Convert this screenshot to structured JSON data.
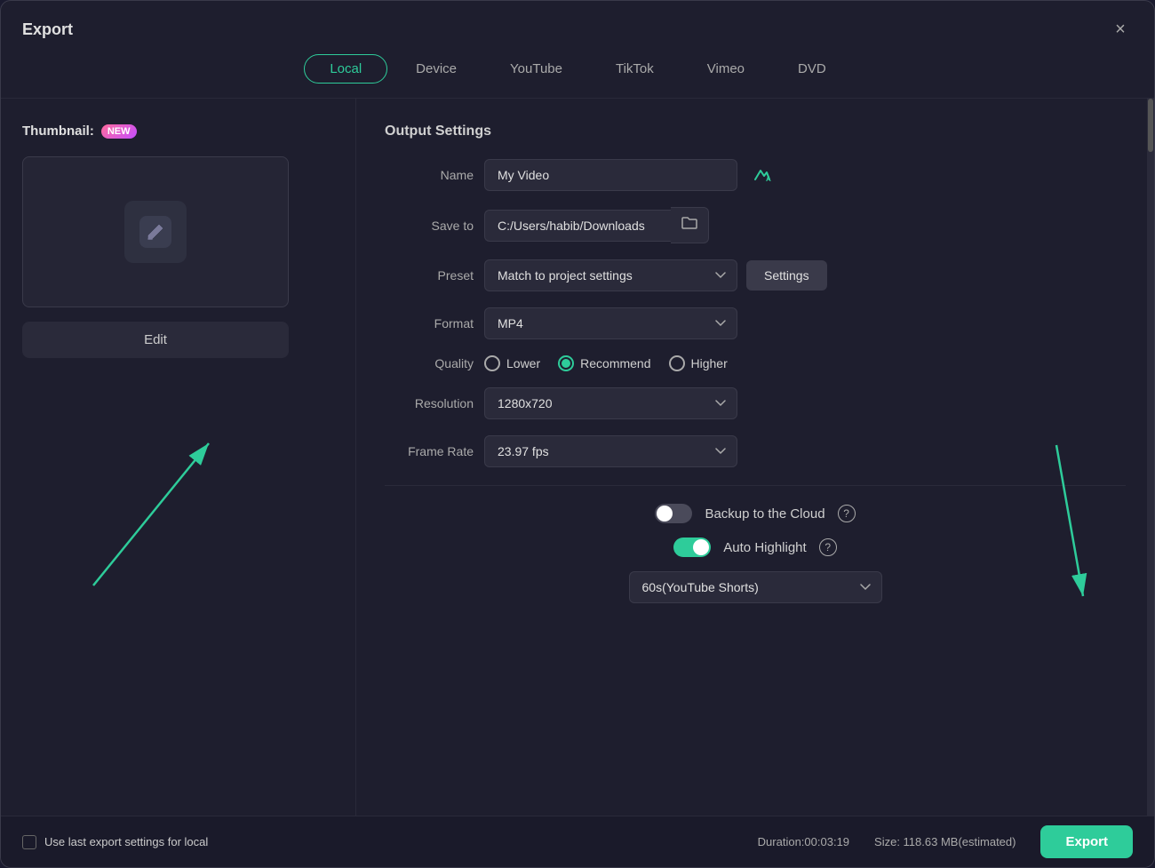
{
  "dialog": {
    "title": "Export",
    "close_label": "×"
  },
  "tabs": [
    {
      "id": "local",
      "label": "Local",
      "active": true
    },
    {
      "id": "device",
      "label": "Device",
      "active": false
    },
    {
      "id": "youtube",
      "label": "YouTube",
      "active": false
    },
    {
      "id": "tiktok",
      "label": "TikTok",
      "active": false
    },
    {
      "id": "vimeo",
      "label": "Vimeo",
      "active": false
    },
    {
      "id": "dvd",
      "label": "DVD",
      "active": false
    }
  ],
  "left": {
    "thumbnail_label": "Thumbnail:",
    "new_badge": "NEW",
    "edit_button": "Edit"
  },
  "output": {
    "section_title": "Output Settings",
    "name_label": "Name",
    "name_value": "My Video",
    "save_to_label": "Save to",
    "save_to_value": "C:/Users/habib/Downloads",
    "preset_label": "Preset",
    "preset_value": "Match to project settings",
    "settings_button": "Settings",
    "format_label": "Format",
    "format_value": "MP4",
    "quality_label": "Quality",
    "quality_lower": "Lower",
    "quality_recommend": "Recommend",
    "quality_higher": "Higher",
    "resolution_label": "Resolution",
    "resolution_value": "1280x720",
    "frame_rate_label": "Frame Rate",
    "frame_rate_value": "23.97 fps",
    "backup_label": "Backup to the Cloud",
    "auto_highlight_label": "Auto Highlight",
    "youtube_shorts_value": "60s(YouTube Shorts)"
  },
  "bottom": {
    "checkbox_label": "Use last export settings for local",
    "duration_label": "Duration:00:03:19",
    "size_label": "Size: 118.63 MB(estimated)",
    "export_button": "Export"
  }
}
